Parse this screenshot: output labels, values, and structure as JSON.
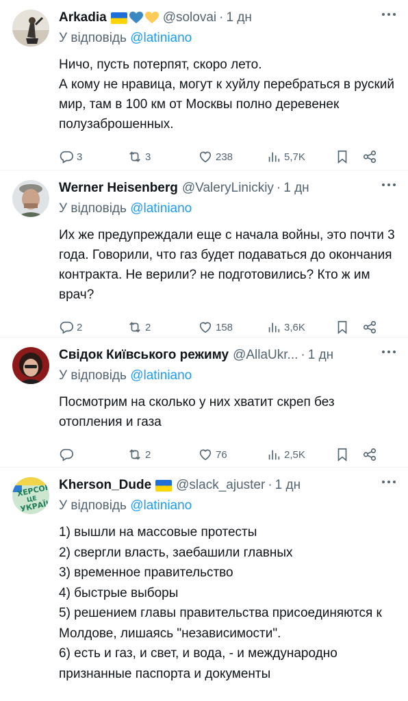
{
  "tweets": [
    {
      "name": "Arkadia",
      "badges": [
        "ukraine-flag",
        "blue-heart",
        "yellow-heart"
      ],
      "handle": "@solovai",
      "time": "1 дн",
      "reply_prefix": "У відповідь",
      "reply_to": "@latiniano",
      "text": "Ничо, пусть потерпят, скоро лето.\nА кому не нравица, могут к хуйлу перебраться в руский мир, там в 100 км от Москвы полно деревенек полузаброшенных.",
      "replies": "3",
      "retweets": "3",
      "likes": "238",
      "views": "5,7K"
    },
    {
      "name": "Werner Heisenberg",
      "badges": [],
      "handle": "@ValeryLinickiy",
      "time": "1 дн",
      "reply_prefix": "У відповідь",
      "reply_to": "@latiniano",
      "text": "Их же предупреждали еще с начала войны, это почти 3 года. Говорили, что газ будет подаваться до окончания контракта. Не верили? не подготовились? Кто ж им врач?",
      "replies": "2",
      "retweets": "2",
      "likes": "158",
      "views": "3,6K"
    },
    {
      "name": "Свідок Київського режиму",
      "badges": [],
      "handle": "@AllaUkr...",
      "time": "1 дн",
      "reply_prefix": "У відповідь",
      "reply_to": "@latiniano",
      "text": "Посмотрим на сколько у них хватит скреп без отопления и газа",
      "replies": "",
      "retweets": "2",
      "likes": "76",
      "views": "2,5K"
    },
    {
      "name": "Kherson_Dude",
      "badges": [
        "ukraine-flag"
      ],
      "handle": "@slack_ajuster",
      "time": "1 дн",
      "reply_prefix": "У відповідь",
      "reply_to": "@latiniano",
      "text": "1) вышли на массовые протесты\n2) свергли власть, заебашили главных\n3) временное правительство\n4) быстрые выборы\n5) решением главы правительства присоединяются к Молдове, лишаясь \"независимости\".\n6) есть и газ, и свет, и вода, - и международно признанные паспорта и документы",
      "avatar_text": "ХЕРСОН ЦЕ УКРАЇНА"
    }
  ],
  "colors": {
    "link": "#1d9bf0",
    "secondary": "#536471",
    "primary_text": "#0f1419",
    "divider": "#eff3f4"
  }
}
